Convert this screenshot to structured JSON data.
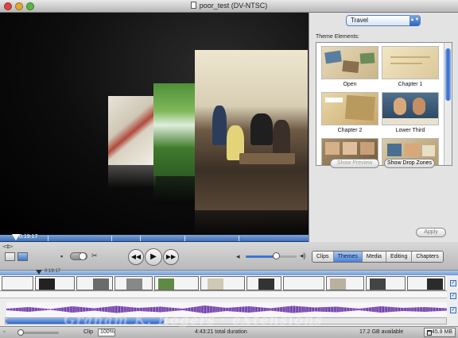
{
  "window": {
    "title": "poor_test (DV-NTSC)"
  },
  "viewer": {
    "timecode": "0:19:17"
  },
  "themes_panel": {
    "theme_selected": "Travel",
    "elements_label": "Theme Elements:",
    "items": [
      {
        "label": "Open"
      },
      {
        "label": "Chapter 1"
      },
      {
        "label": "Chapter 2"
      },
      {
        "label": "Lower Third"
      },
      {
        "label": ""
      },
      {
        "label": ""
      }
    ],
    "show_preview": "Show Preview",
    "show_drop_zones": "Show Drop Zones",
    "apply": "Apply"
  },
  "toolbar": {
    "tabs": [
      "Clips",
      "Themes",
      "Media",
      "Editing",
      "Chapters"
    ],
    "active_tab": "Themes",
    "volume_level": 0.6
  },
  "timeline": {
    "playhead_time": "0:19:17"
  },
  "status": {
    "clip_label": "Clip",
    "clip_size": "100%",
    "duration": "4:43:21 total duration",
    "disk": "17.2 GB available",
    "trash": "45.9 MB"
  },
  "watermark": "Graham K. Rogers · eXtensions"
}
